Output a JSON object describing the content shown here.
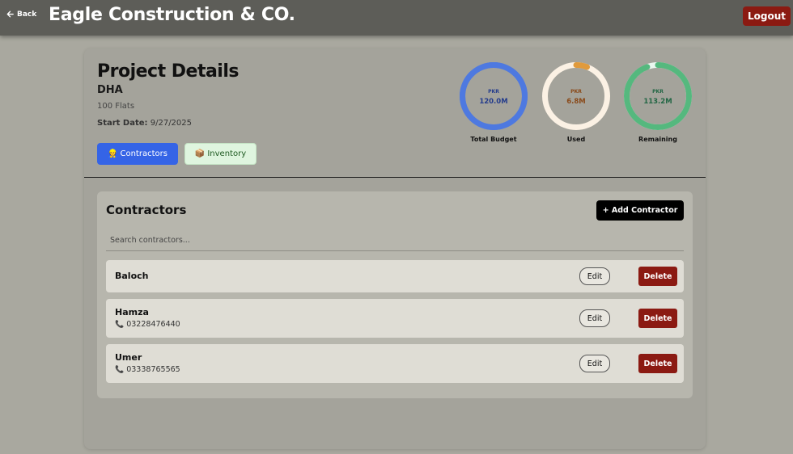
{
  "topbar": {
    "back_label": "Back",
    "brand": "Eagle Construction & CO.",
    "logout_label": "Logout"
  },
  "project": {
    "title": "Project Details",
    "location": "DHA",
    "units": "100 Flats",
    "start_label": "Start Date:",
    "start_date": "9/27/2025"
  },
  "tabs": [
    {
      "label": "Contractors",
      "icon": "worker-icon"
    },
    {
      "label": "Inventory",
      "icon": "package-icon"
    }
  ],
  "budget": {
    "currency": "PKR",
    "gauges": [
      {
        "label": "Total Budget",
        "value": "120.0M",
        "fraction": 1.0,
        "color": "#4e79e0",
        "text_color": "#243c8c",
        "track": "#4e79e0"
      },
      {
        "label": "Used",
        "value": "6.8M",
        "fraction": 0.057,
        "color": "#e09a3c",
        "text_color": "#8a4a1a",
        "track": "#fbf1e4"
      },
      {
        "label": "Remaining",
        "value": "113.2M",
        "fraction": 0.943,
        "color": "#55b87e",
        "text_color": "#226644",
        "track": "#eaf7ef"
      }
    ]
  },
  "contractors": {
    "title": "Contractors",
    "add_label": "+ Add Contractor",
    "search_placeholder": "Search contractors...",
    "edit_label": "Edit",
    "delete_label": "Delete",
    "items": [
      {
        "name": "Baloch",
        "phone": ""
      },
      {
        "name": "Hamza",
        "phone": "03228476440"
      },
      {
        "name": "Umer",
        "phone": "03338765565"
      }
    ]
  },
  "colors": {
    "topbar": "#5d5d58",
    "danger": "#8b1a12",
    "primary": "#3564e6"
  }
}
